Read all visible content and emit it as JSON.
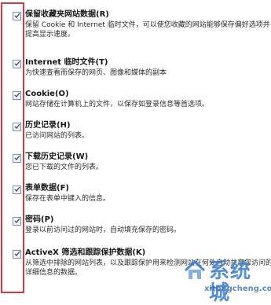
{
  "options": [
    {
      "title": "保留收藏夹网站数据(R)",
      "description": "保留 Cookie 和 Internet 临时文件，可以使您收藏的网站能够保存偏好选项并提高显示速度。",
      "checked": true
    },
    {
      "title": "Internet 临时文件(T)",
      "description": "为快速查看而保存的网页、图像和媒体的副本",
      "checked": true
    },
    {
      "title": "Cookie(O)",
      "description": "网站存储在计算机上的文件，以保存如登录信息等首选项。",
      "checked": true
    },
    {
      "title": "历史记录(H)",
      "description": "已访问网站的列表。",
      "checked": true
    },
    {
      "title": "下载历史记录(W)",
      "description": "您已下载的文件的列表。",
      "checked": true
    },
    {
      "title": "表单数据(F)",
      "description": "保存在表单中键入的信息。",
      "checked": true
    },
    {
      "title": "密码(P)",
      "description": "登录以前访问过的网站时，自动填充保存的密码。",
      "checked": true
    },
    {
      "title": "ActiveX 筛选和跟踪保护数据(K)",
      "description": "从筛选中排除的网站列表，以及跟踪保护用来检测网站在何处自动共享您访问的详细信息的数据。",
      "checked": true
    }
  ],
  "watermark": {
    "brand": "系统城",
    "site": "xitongcheng.com"
  },
  "colors": {
    "highlight_border": "#d6383d",
    "checkbox_border": "#7d8ea7",
    "checkmark": "#2f4f7f",
    "watermark": "#367bcc"
  }
}
